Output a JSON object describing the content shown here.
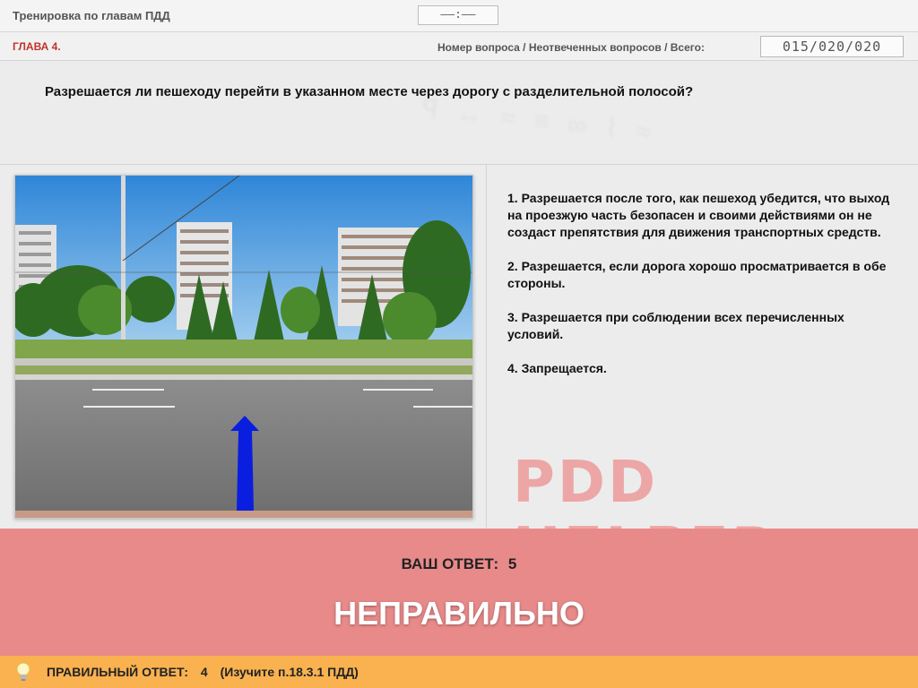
{
  "header": {
    "title": "Тренировка по главам ПДД",
    "timer": "––:––"
  },
  "chapter_bar": {
    "chapter": "ГЛАВА 4.",
    "counter_label": "Номер вопроса / Неотвеченных вопросов / Всего:",
    "counter_value": "015/020/020"
  },
  "question": {
    "text": "Разрешается ли пешеходу перейти в указанном месте через дорогу с разделительной полосой?"
  },
  "answers": [
    {
      "label": "1.  Разрешается после того, как пешеход убедится, что выход на проезжую часть безопасен и своими действиями он не создаст препятствия для движения транспортных средств."
    },
    {
      "label": "2.  Разрешается, если дорога хорошо просматривается в обе стороны."
    },
    {
      "label": "3.  Разрешается при соблюдении всех перечисленных условий."
    },
    {
      "label": "4.  Запрещается."
    }
  ],
  "watermark": "PDD HELPER",
  "result": {
    "your_answer_label": "ВАШ  ОТВЕТ:",
    "your_answer_value": "5",
    "verdict": "НЕПРАВИЛЬНО"
  },
  "correct": {
    "label": "ПРАВИЛЬНЫЙ ОТВЕТ:",
    "value": "4",
    "hint": "(Изучите п.18.3.1 ПДД)",
    "icon": "lightbulb-icon"
  },
  "colors": {
    "result_bg": "#e88a8a",
    "correct_bg": "#f9b24f",
    "chapter_text": "#c0342c",
    "arrow": "#0a1ee0"
  }
}
